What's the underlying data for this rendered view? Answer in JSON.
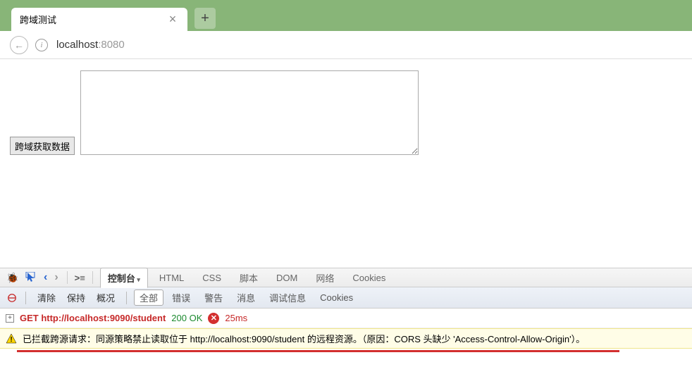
{
  "tab": {
    "title": "跨域测试"
  },
  "url": {
    "host": "localhost",
    "port": ":8080"
  },
  "page": {
    "button_label": "跨域获取数据"
  },
  "devtools": {
    "panels": {
      "console": "控制台",
      "html": "HTML",
      "css": "CSS",
      "script": "脚本",
      "dom": "DOM",
      "network": "网络",
      "cookies": "Cookies"
    },
    "sub": {
      "clear": "清除",
      "persist": "保持",
      "overview": "概况",
      "all": "全部",
      "errors": "错误",
      "warnings": "警告",
      "info": "消息",
      "debug": "调试信息",
      "cookies": "Cookies"
    },
    "log": {
      "method_url": "GET http://localhost:9090/student",
      "status": "200 OK",
      "timing": "25ms"
    },
    "warning": "已拦截跨源请求：同源策略禁止读取位于 http://localhost:9090/student 的远程资源。（原因：CORS 头缺少 'Access-Control-Allow-Origin'）。"
  }
}
